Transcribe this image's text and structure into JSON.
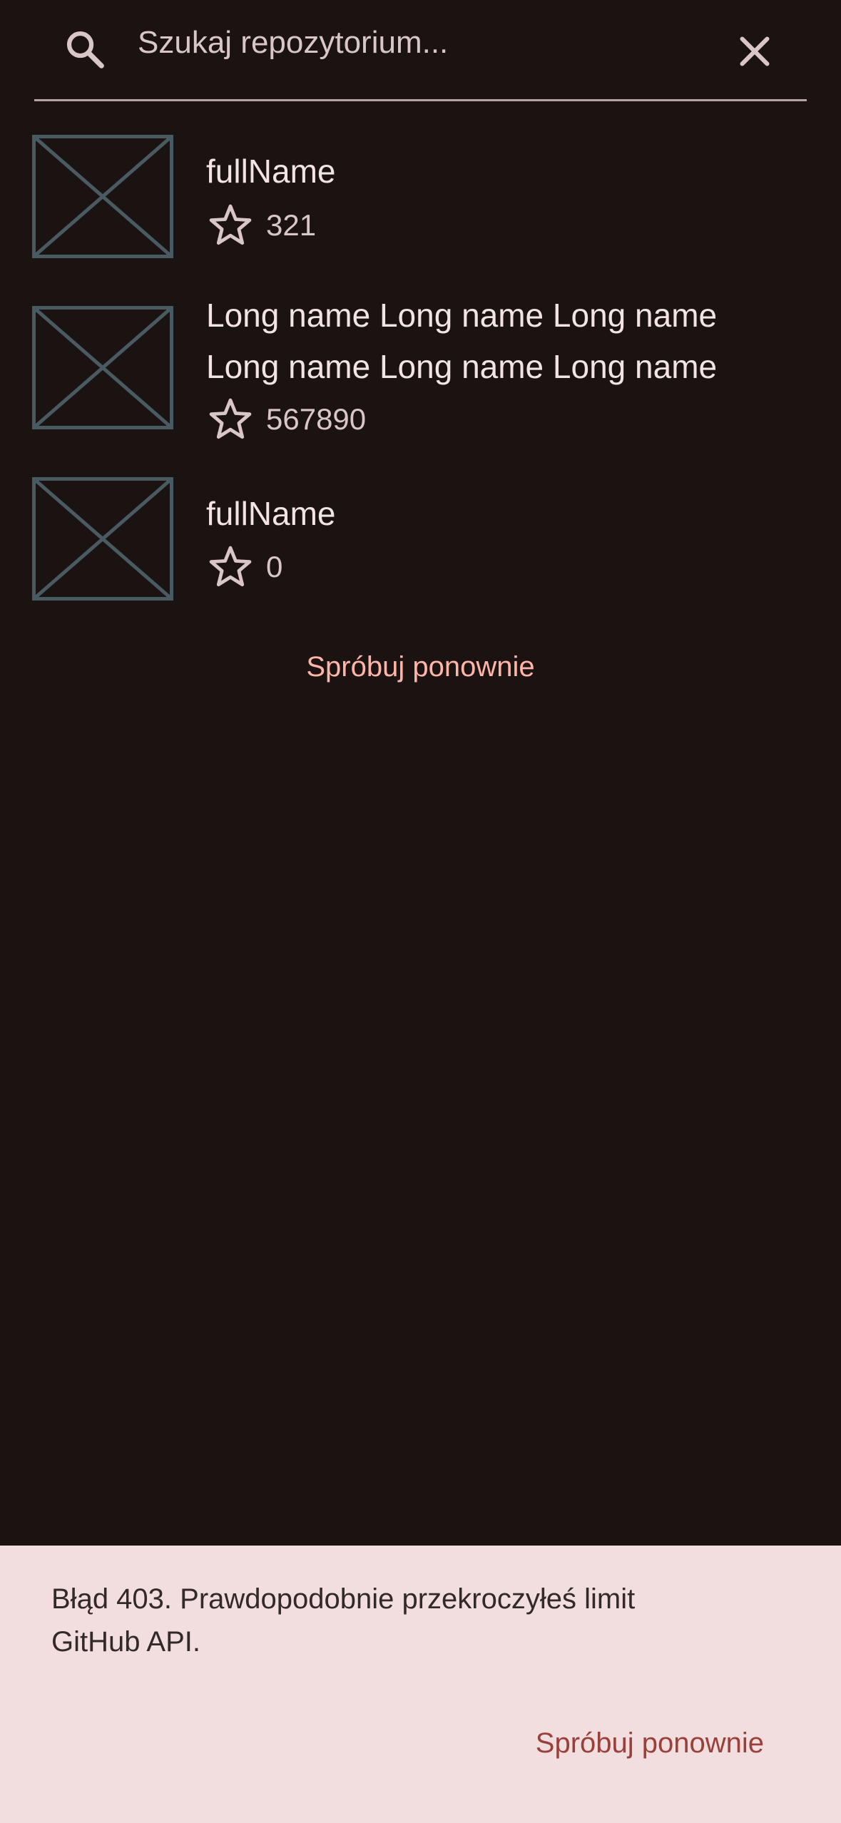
{
  "search": {
    "placeholder": "Szukaj repozytorium...",
    "value": ""
  },
  "repos": [
    {
      "full_name": "fullName",
      "stars": "321"
    },
    {
      "full_name": "Long name Long name Long name Long name Long name Long name",
      "stars": "567890"
    },
    {
      "full_name": "fullName",
      "stars": "0"
    }
  ],
  "list_retry_label": "Spróbuj ponownie",
  "snackbar": {
    "message": "Błąd 403. Prawdopodobnie przekroczyłeś limit GitHub API.",
    "action_label": "Spróbuj ponownie"
  },
  "colors": {
    "background": "#1b1212",
    "accent": "#ffb4a8",
    "snackbar_bg": "#f2dede",
    "snackbar_action": "#9a403a",
    "placeholder_stroke": "#4a5a62"
  }
}
